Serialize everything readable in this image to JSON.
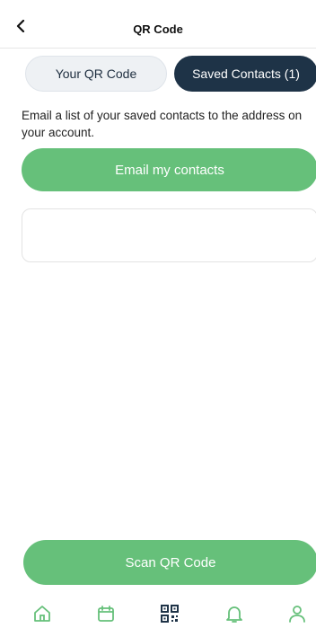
{
  "header": {
    "title": "QR Code",
    "back_icon": "chevron-left-icon"
  },
  "tabs": [
    {
      "label": "Your QR Code",
      "active": false
    },
    {
      "label": "Saved Contacts (1)",
      "active": true
    }
  ],
  "description": "Email a list of your saved contacts to the address on your account.",
  "email_button": {
    "label": "Email my contacts"
  },
  "saved_contact": {
    "text": ""
  },
  "scan_button": {
    "label": "Scan QR Code"
  },
  "tabbar": {
    "items": [
      {
        "icon": "home-icon",
        "active": false
      },
      {
        "icon": "calendar-icon",
        "active": false
      },
      {
        "icon": "qr-code-icon",
        "active": true
      },
      {
        "icon": "bell-icon",
        "active": false
      },
      {
        "icon": "profile-icon",
        "active": false
      }
    ]
  },
  "colors": {
    "accent": "#66c07a",
    "navy": "#1e3347",
    "tab_inactive_bg": "#eef1f4"
  }
}
